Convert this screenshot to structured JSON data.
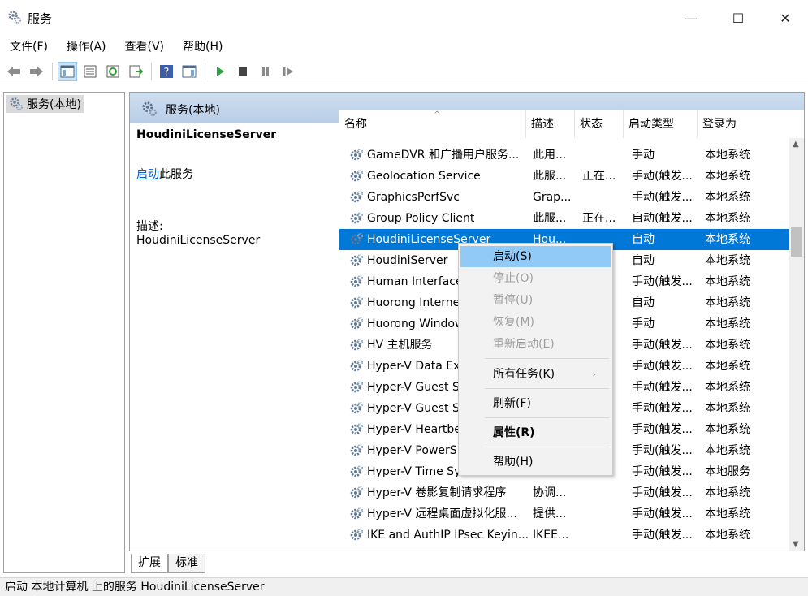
{
  "window": {
    "title": "服务",
    "minimize": "—",
    "maximize": "☐",
    "close": "✕"
  },
  "menu": [
    "文件(F)",
    "操作(A)",
    "查看(V)",
    "帮助(H)"
  ],
  "tree": {
    "node_label": "服务(本地)"
  },
  "panel": {
    "header_title": "服务(本地)"
  },
  "detail": {
    "service_name": "HoudiniLicenseServer",
    "start_link": "启动",
    "start_suffix": "此服务",
    "desc_label": "描述:",
    "desc_text": "HoudiniLicenseServer"
  },
  "columns": {
    "name": "名称",
    "desc": "描述",
    "status": "状态",
    "startup": "启动类型",
    "logon": "登录为"
  },
  "rows": [
    {
      "name": "GameDVR 和广播用户服务...",
      "desc": "此用...",
      "status": "",
      "startup": "手动",
      "logon": "本地系统"
    },
    {
      "name": "Geolocation Service",
      "desc": "此服...",
      "status": "正在...",
      "startup": "手动(触发...",
      "logon": "本地系统"
    },
    {
      "name": "GraphicsPerfSvc",
      "desc": "Grap...",
      "status": "",
      "startup": "手动(触发...",
      "logon": "本地系统"
    },
    {
      "name": "Group Policy Client",
      "desc": "此服...",
      "status": "正在...",
      "startup": "自动(触发...",
      "logon": "本地系统"
    },
    {
      "name": "HoudiniLicenseServer",
      "desc": "Hou...",
      "status": "",
      "startup": "自动",
      "logon": "本地系统"
    },
    {
      "name": "HoudiniServer",
      "desc": "",
      "status": "",
      "startup": "自动",
      "logon": "本地系统"
    },
    {
      "name": "Human Interface",
      "desc": "",
      "status": "",
      "startup": "手动(触发...",
      "logon": "本地系统"
    },
    {
      "name": "Huorong Interne",
      "desc": "",
      "status": "",
      "startup": "自动",
      "logon": "本地系统"
    },
    {
      "name": "Huorong Window",
      "desc": "",
      "status": "",
      "startup": "手动",
      "logon": "本地系统"
    },
    {
      "name": "HV 主机服务",
      "desc": "",
      "status": "",
      "startup": "手动(触发...",
      "logon": "本地系统"
    },
    {
      "name": "Hyper-V Data Ex",
      "desc": "",
      "status": "",
      "startup": "手动(触发...",
      "logon": "本地系统"
    },
    {
      "name": "Hyper-V Guest S",
      "desc": "",
      "status": "",
      "startup": "手动(触发...",
      "logon": "本地系统"
    },
    {
      "name": "Hyper-V Guest S",
      "desc": "",
      "status": "",
      "startup": "手动(触发...",
      "logon": "本地系统"
    },
    {
      "name": "Hyper-V Heartbe",
      "desc": "",
      "status": "",
      "startup": "手动(触发...",
      "logon": "本地系统"
    },
    {
      "name": "Hyper-V PowerS",
      "desc": "",
      "status": "",
      "startup": "手动(触发...",
      "logon": "本地系统"
    },
    {
      "name": "Hyper-V Time Sy",
      "desc": "",
      "status": "",
      "startup": "手动(触发...",
      "logon": "本地服务"
    },
    {
      "name": "Hyper-V 卷影复制请求程序",
      "desc": "协调...",
      "status": "",
      "startup": "手动(触发...",
      "logon": "本地系统"
    },
    {
      "name": "Hyper-V 远程桌面虚拟化服...",
      "desc": "提供...",
      "status": "",
      "startup": "手动(触发...",
      "logon": "本地系统"
    },
    {
      "name": "IKE and AuthIP IPsec Keyin...",
      "desc": "IKEE...",
      "status": "",
      "startup": "手动(触发...",
      "logon": "本地系统"
    }
  ],
  "context_menu": {
    "start": "启动(S)",
    "stop": "停止(O)",
    "pause": "暂停(U)",
    "resume": "恢复(M)",
    "restart": "重新启动(E)",
    "all_tasks": "所有任务(K)",
    "refresh": "刷新(F)",
    "properties": "属性(R)",
    "help": "帮助(H)"
  },
  "tabs": [
    "扩展",
    "标准"
  ],
  "status_bar": "启动 本地计算机 上的服务 HoudiniLicenseServer",
  "colors": {
    "selection": "#0078d7",
    "menu_hover": "#91c9f7",
    "link": "#0a58c8",
    "header_band": "#b7cde6"
  }
}
